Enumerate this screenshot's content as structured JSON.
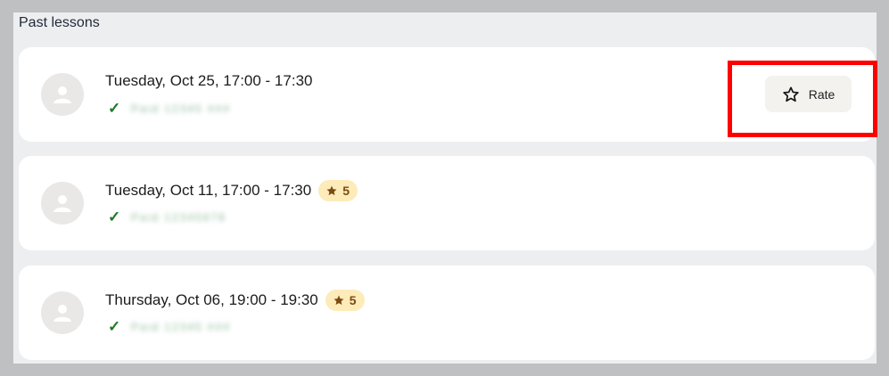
{
  "section": {
    "title": "Past lessons"
  },
  "lessons": [
    {
      "title": "Tuesday, Oct 25, 17:00 - 17:30",
      "status_text": "Paid 12345 ###",
      "action_label": "Rate"
    },
    {
      "title": "Tuesday, Oct 11, 17:00 - 17:30",
      "status_text": "Paid 12345678",
      "rating": "5"
    },
    {
      "title": "Thursday, Oct 06, 19:00 - 19:30",
      "status_text": "Paid 12345 ###",
      "rating": "5"
    }
  ],
  "icons": {
    "check": "✓",
    "rating": "star-icon",
    "rate": "star-outline-icon",
    "avatar": "user-silhouette-icon"
  },
  "colors": {
    "highlight": "#ff0000",
    "badge_bg": "#fdebb9",
    "check": "#1c7a25"
  }
}
